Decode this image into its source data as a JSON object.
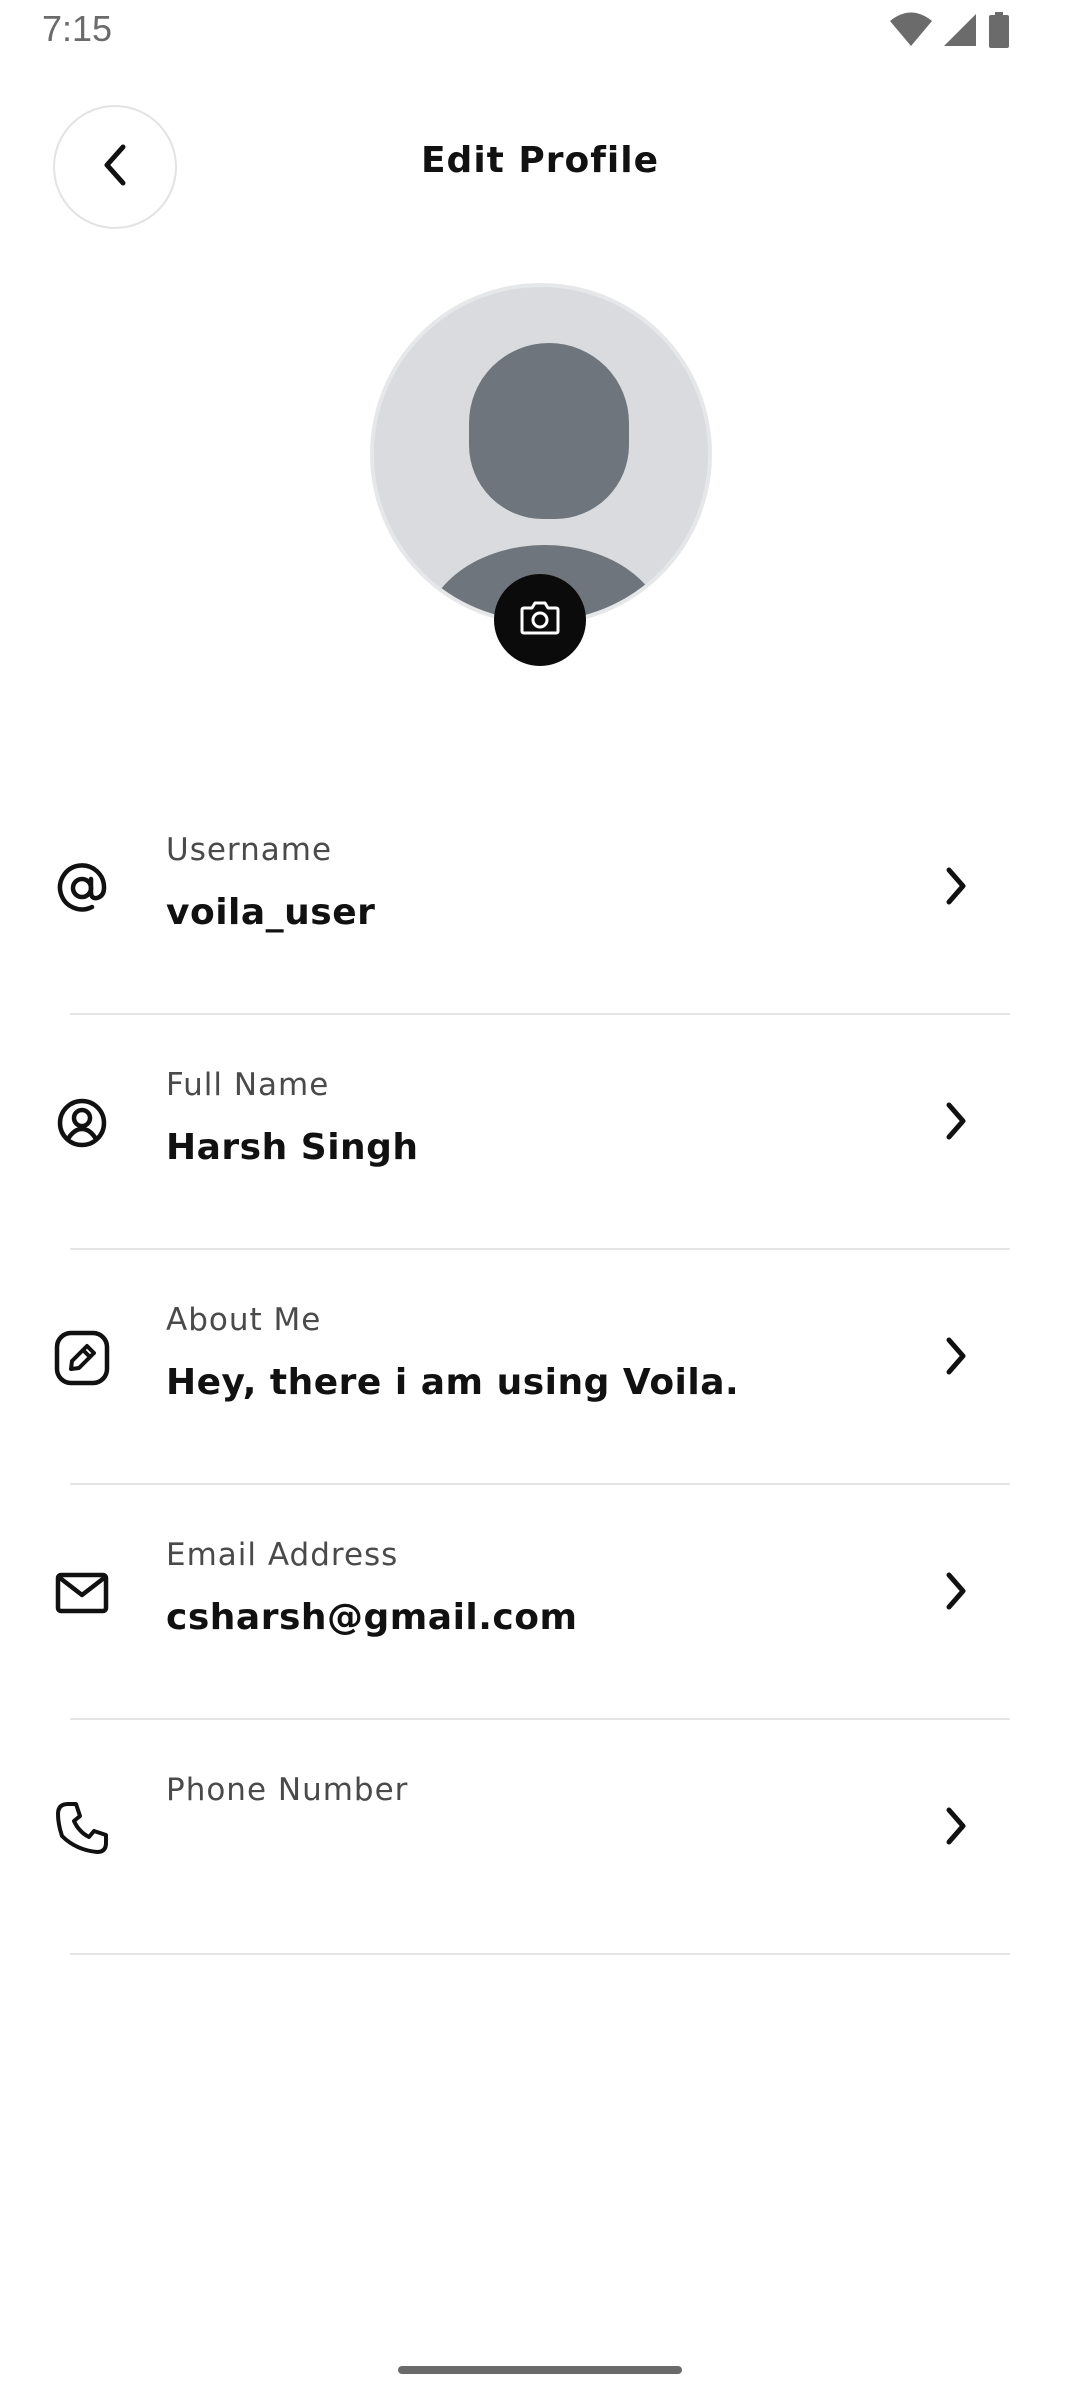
{
  "status_bar": {
    "time": "7:15",
    "icons": [
      "wifi-icon",
      "signal-icon",
      "battery-icon"
    ]
  },
  "header": {
    "title": "Edit Profile",
    "back_icon": "chevron-left-icon"
  },
  "avatar": {
    "icon": "default-avatar",
    "camera_icon": "camera-icon"
  },
  "fields": [
    {
      "icon": "at-sign-icon",
      "label": "Username",
      "value": "voila_user"
    },
    {
      "icon": "user-circle-icon",
      "label": "Full Name",
      "value": "Harsh Singh"
    },
    {
      "icon": "edit-icon",
      "label": "About Me",
      "value": "Hey, there i am using Voila."
    },
    {
      "icon": "mail-icon",
      "label": "Email Address",
      "value": "csharsh@gmail.com"
    },
    {
      "icon": "phone-icon",
      "label": "Phone Number",
      "value": ""
    }
  ],
  "colors": {
    "background": "#ffffff",
    "text": "#111111",
    "label": "#4a4a4a",
    "avatar_bg": "#d9dbde",
    "avatar_fg": "#6f757d",
    "camera_bg": "#0b0b0b",
    "divider": "#e5e5e5"
  }
}
